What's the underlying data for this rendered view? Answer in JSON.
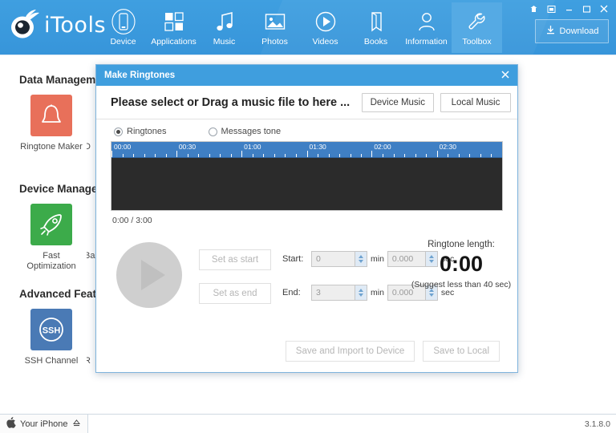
{
  "app": {
    "brand": "iTools",
    "version": "3.1.8.0"
  },
  "header": {
    "nav": [
      {
        "label": "Device",
        "icon": "device-icon",
        "active": false
      },
      {
        "label": "Applications",
        "icon": "applications-icon",
        "active": false
      },
      {
        "label": "Music",
        "icon": "music-icon",
        "active": false
      },
      {
        "label": "Photos",
        "icon": "photos-icon",
        "active": false
      },
      {
        "label": "Videos",
        "icon": "videos-icon",
        "active": false
      },
      {
        "label": "Books",
        "icon": "books-icon",
        "active": false
      },
      {
        "label": "Information",
        "icon": "information-icon",
        "active": false
      },
      {
        "label": "Toolbox",
        "icon": "toolbox-icon",
        "active": true
      }
    ],
    "download_label": "Download",
    "window_buttons": [
      "pin-icon",
      "restore-icon",
      "minimize-icon",
      "maximize-icon",
      "close-icon"
    ],
    "accent": "#3795da",
    "active_tab_bg": "#55aae4"
  },
  "page": {
    "sections": [
      {
        "title": "Data Management"
      },
      {
        "title": "Device Management"
      },
      {
        "title": "Advanced Features"
      }
    ],
    "tiles": [
      {
        "label": "Ringtone Maker",
        "icon": "bell-icon",
        "color": "#e8705a",
        "partial": ""
      },
      {
        "label": "D",
        "icon": "cut-icon",
        "color": "#e8705a",
        "partial": "true"
      },
      {
        "label": "Fast\nOptimization",
        "icon": "rocket-icon",
        "color": "#3cab4a",
        "partial": ""
      },
      {
        "label": "Ba",
        "icon": "backup-icon",
        "color": "#3cab4a",
        "partial": "true"
      },
      {
        "label": "SSH Channel",
        "icon": "ssh-icon",
        "color": "#4a7ab5",
        "partial": ""
      },
      {
        "label": "R",
        "icon": "reboot-icon",
        "color": "#4a7ab5",
        "partial": "true"
      }
    ]
  },
  "statusbar": {
    "device_name": "Your iPhone",
    "apple_icon": "apple-icon",
    "eject_icon": "eject-icon",
    "version": "3.1.8.0"
  },
  "dialog": {
    "title": "Make Ringtones",
    "close_icon": "close-icon",
    "prompt": "Please select or Drag a music file to here ...",
    "device_music_label": "Device Music",
    "local_music_label": "Local Music",
    "radios": [
      {
        "label": "Ringtones",
        "selected": true
      },
      {
        "label": "Messages tone",
        "selected": false
      }
    ],
    "ruler": {
      "labels": [
        "00:00",
        "00:30",
        "01:00",
        "01:30",
        "02:00",
        "02:30"
      ],
      "label_positions": [
        0,
        16.6,
        33.3,
        50.0,
        66.6,
        83.3
      ],
      "background": "#3f7fc4"
    },
    "waveform_bg": "#2b2b2b",
    "time_position": "0:00 / 3:00",
    "play_icon": "play-icon",
    "set_as_start_label": "Set as start",
    "set_as_end_label": "Set as end",
    "start": {
      "label": "Start:",
      "min_value": "0",
      "min_unit": "min",
      "sec_value": "0.000",
      "sec_unit": "sec"
    },
    "end": {
      "label": "End:",
      "min_value": "3",
      "min_unit": "min",
      "sec_value": "0.000",
      "sec_unit": "sec"
    },
    "length_title": "Ringtone length:",
    "length_value": "0:00",
    "length_hint": "(Suggest less than 40 sec)",
    "save_import_label": "Save and Import to Device",
    "save_local_label": "Save to Local"
  }
}
